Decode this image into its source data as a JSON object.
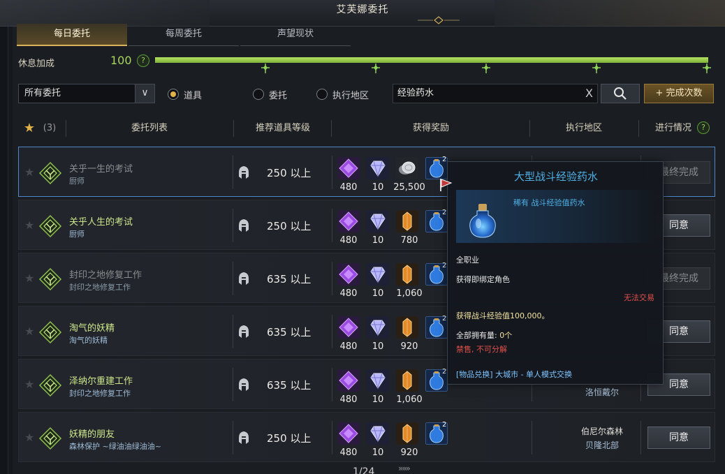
{
  "window": {
    "title": "艾芙娜委托"
  },
  "tabs": [
    {
      "label": "每日委托",
      "active": true
    },
    {
      "label": "每周委托",
      "active": false
    },
    {
      "label": "声望现状",
      "active": false
    }
  ],
  "rest": {
    "label": "休息加成",
    "value": "100",
    "help": "?",
    "progress": 1.0,
    "fill_color": "#a6d64e"
  },
  "filters": {
    "select_value": "所有委托",
    "select_arrow": "∨",
    "radios": [
      {
        "label": "道具",
        "selected": true
      },
      {
        "label": "委托",
        "selected": false
      },
      {
        "label": "执行地区",
        "selected": false
      }
    ],
    "search_value": "经验药水",
    "clear_glyph": "X",
    "complete_button": "+ 完成次数"
  },
  "headers": {
    "star_glyph": "★",
    "favorites": "(3)",
    "quest_list": "委托列表",
    "recommended_level": "推荐道具等级",
    "rewards": "获得奖励",
    "region": "执行地区",
    "progress": "进行情况",
    "help": "?"
  },
  "rows": [
    {
      "name": "关乎一生的考试",
      "sub": "厨师",
      "level": "250 以上",
      "r1": "480",
      "r2": "10",
      "r3": "25,500",
      "r3_type": "coin",
      "badge": "2",
      "region": "",
      "region2": "",
      "action": "最终完成",
      "enabled": false,
      "selected": true
    },
    {
      "name": "关乎人生的考试",
      "sub": "厨师",
      "level": "250 以上",
      "r1": "480",
      "r2": "10",
      "r3": "780",
      "r3_type": "ore",
      "badge": "2",
      "region": "",
      "region2": "",
      "action": "同意",
      "enabled": true,
      "selected": false
    },
    {
      "name": "封印之地修复工作",
      "sub": "封印之地修复工作",
      "level": "635 以上",
      "r1": "480",
      "r2": "10",
      "r3": "1,060",
      "r3_type": "ore",
      "badge": "2",
      "region": "",
      "region2": "",
      "action": "最终完成",
      "enabled": false,
      "selected": false
    },
    {
      "name": "淘气的妖精",
      "sub": "淘气的妖精",
      "level": "635 以上",
      "r1": "480",
      "r2": "10",
      "r3": "920",
      "r3_type": "ore",
      "badge": "2",
      "region": "",
      "region2": "",
      "action": "同意",
      "enabled": true,
      "selected": false
    },
    {
      "name": "泽纳尔重建工作",
      "sub": "封印之地修复工作",
      "level": "635 以上",
      "r1": "480",
      "r2": "10",
      "r3": "1,060",
      "r3_type": "ore",
      "badge": "2",
      "region": "",
      "region2": "洛恒戴尔",
      "action": "同意",
      "enabled": true,
      "selected": false
    },
    {
      "name": "妖精的朋友",
      "sub": "森林保护 ~绿油油绿油油~",
      "level": "250 以上",
      "r1": "480",
      "r2": "10",
      "r3": "920",
      "r3_type": "ore",
      "badge": "2",
      "region": "伯尼尔森林",
      "region2": "贝隆北部",
      "action": "同意",
      "enabled": true,
      "selected": false
    }
  ],
  "pager": {
    "text": "1/24",
    "next": "»»»"
  },
  "tooltip": {
    "title": "大型战斗经验药水",
    "rarity": "稀有 战斗经验值药水",
    "class": "全职业",
    "bind": "获得即绑定角色",
    "no_trade": "无法交易",
    "effect": "获得战斗经验值100,000。",
    "owned_label": "全部拥有量:",
    "owned_value": "0个",
    "restrictions": "禁售, 不可分解",
    "exchange": "[物品兑换] 大城市 - 单人模式交换"
  }
}
